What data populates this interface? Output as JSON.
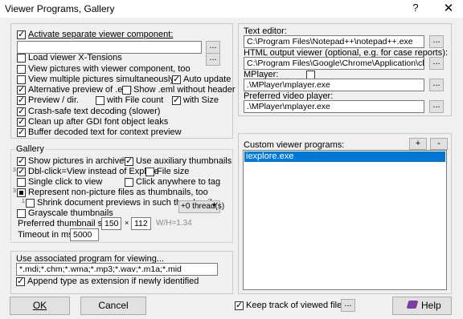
{
  "window": {
    "title": "Viewer Programs, Gallery",
    "help_glyph": "?",
    "close_glyph": "✕"
  },
  "left": {
    "activate_label": "Activate separate viewer component:",
    "component_path": "",
    "dots": "...",
    "load_xt": "Load viewer X-Tensions",
    "view_pics_component": "View pictures with viewer component, too",
    "view_multiple": "View multiple pictures simultaneously",
    "auto_update": "Auto update",
    "alt_preview_eml": "Alternative preview of .eml",
    "show_eml_header": "Show .eml without header",
    "preview_dir": "Preview / dir.",
    "with_file_count": "with File count",
    "with_size": "with Size",
    "crash_safe": "Crash-safe text decoding (slower)",
    "cleanup_gdi": "Clean up after GDI font object leaks",
    "buffer_decoded": "Buffer decoded text for context preview"
  },
  "gallery": {
    "title": "Gallery",
    "show_archives": "Show pictures in archives",
    "use_aux_thumbs": "Use auxiliary thumbnails",
    "dblclick": "Dbl-click=View instead of Explore",
    "file_size": "File size",
    "single_click": "Single click to view",
    "click_tag": "Click anywhere to tag",
    "represent_nonpic": "Represent non-picture files as thumbnails, too",
    "shrink_doc": "Shrink document previews in such thumbnails",
    "threads": "+0 thread(s)",
    "grayscale": "Grayscale thumbnails",
    "pref_thumb_size": "Preferred thumbnail size:",
    "thumb_w": "150",
    "times": "×",
    "thumb_h": "112",
    "ratio": "W/H=1.34",
    "timeout_label": "Timeout in ms:",
    "timeout_value": "5000",
    "idx1": "3",
    "idx2": "3",
    "idx3": "3",
    "idx4": "1",
    "idx5": "3"
  },
  "assoc": {
    "label": "Use associated program for viewing...",
    "extensions": "*.mdi;*.chm;*.wma;*.mp3;*.wav;*.m1a;*.mid",
    "append_type": "Append type as extension if newly identified"
  },
  "right": {
    "text_editor_label": "Text editor:",
    "text_editor_path": "C:\\Program Files\\Notepad++\\notepad++.exe",
    "html_viewer_label": "HTML output viewer (optional, e.g. for case reports):",
    "html_viewer_path": "C:\\Program Files\\Google\\Chrome\\Application\\chrome.e",
    "mplayer_label": "MPlayer:",
    "mplayer_path": ".\\MPlayer\\mplayer.exe",
    "pref_video_label": "Preferred video player:",
    "pref_video_path": ".\\MPlayer\\mplayer.exe",
    "custom_label": "Custom viewer programs:",
    "plus": "+",
    "minus": "-",
    "custom_items": [
      "iexplore.exe"
    ]
  },
  "bottom": {
    "ok": "OK",
    "cancel": "Cancel",
    "keep_track": "Keep track of viewed files",
    "help": "Help"
  }
}
